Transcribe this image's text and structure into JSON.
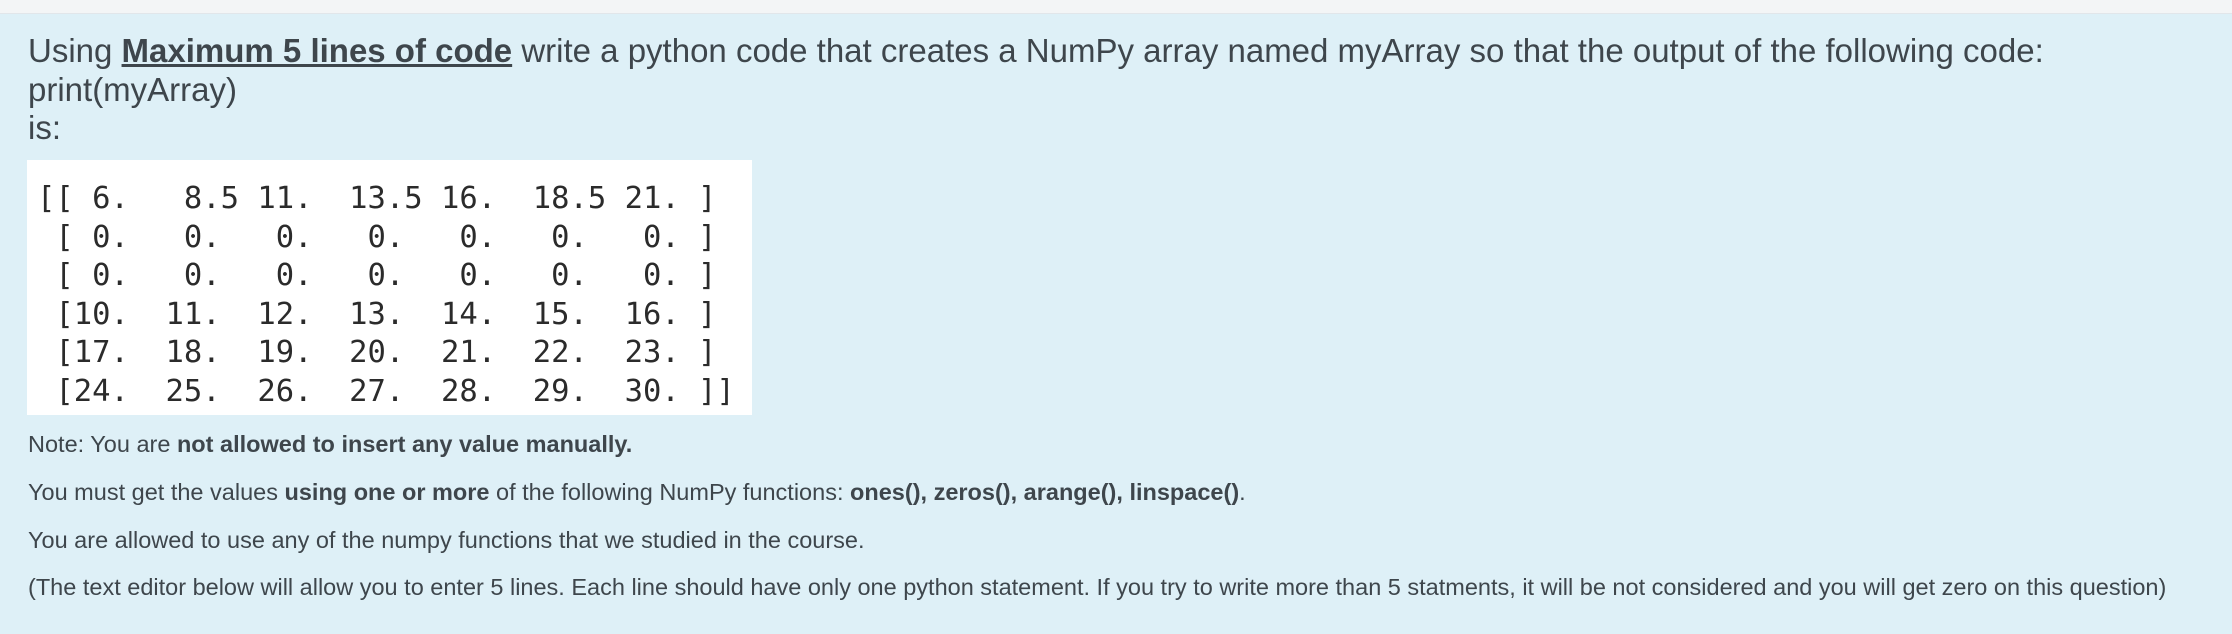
{
  "question": {
    "intro_part1": "Using ",
    "intro_emphasis": "Maximum 5 lines of code",
    "intro_part2": " write a python code that creates a NumPy array named myArray so that the output of the following code:",
    "code_line": "print(myArray)",
    "is_label": "is:",
    "output_lines": [
      "[[ 6.   8.5 11.  13.5 16.  18.5 21. ]",
      " [ 0.   0.   0.   0.   0.   0.   0. ]",
      " [ 0.   0.   0.   0.   0.   0.   0. ]",
      " [10.  11.  12.  13.  14.  15.  16. ]",
      " [17.  18.  19.  20.  21.  22.  23. ]",
      " [24.  25.  26.  27.  28.  29.  30. ]]"
    ],
    "note1_prefix": "Note: You are ",
    "note1_bold": "not allowed to insert any value manually.",
    "note2_prefix": "You must get the values ",
    "note2_bold1": "using one or more",
    "note2_middle": " of the following NumPy functions: ",
    "note2_bold2": "ones(), zeros(), arange(), linspace()",
    "note2_suffix": ".",
    "note3": "You are allowed to use any of the numpy functions that we studied in the course.",
    "note4": "(The text editor below will allow you to enter 5 lines. Each line should have only one python statement. If you try to write more than 5 statments, it will be not considered and you will get zero on this question)"
  }
}
